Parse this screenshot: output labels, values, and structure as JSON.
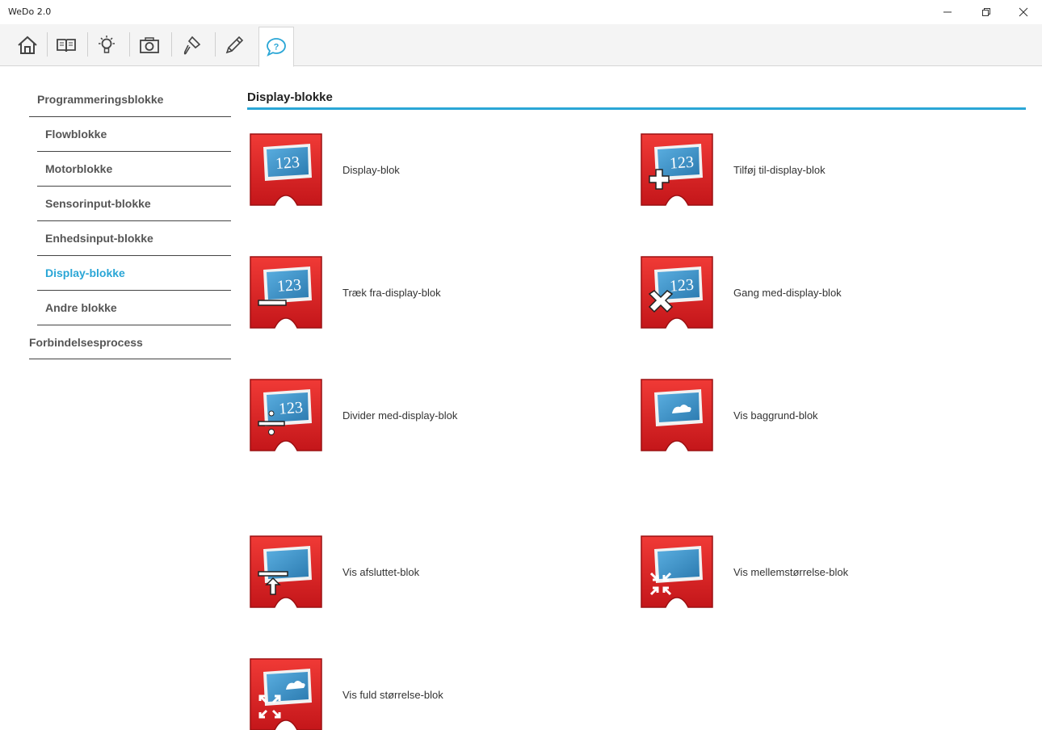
{
  "window": {
    "title": "WeDo 2.0",
    "controls": {
      "minimize": "—",
      "maximize": "❐",
      "close": "✕"
    }
  },
  "toolbar": {
    "buttons": [
      {
        "icon": "home-icon"
      },
      {
        "icon": "book-icon"
      },
      {
        "icon": "lightbulb-icon"
      },
      {
        "icon": "camera-icon"
      },
      {
        "icon": "microphone-icon"
      },
      {
        "icon": "pencil-icon"
      },
      {
        "icon": "help-icon",
        "active": true
      }
    ],
    "accent": "#2aa6d6"
  },
  "sidebar": {
    "top": "Programmeringsblokke",
    "items": [
      {
        "label": "Flowblokke"
      },
      {
        "label": "Motorblokke"
      },
      {
        "label": "Sensorinput-blokke"
      },
      {
        "label": "Enhedsinput-blokke"
      },
      {
        "label": "Display-blokke",
        "active": true
      },
      {
        "label": "Andre blokke"
      }
    ],
    "bottom": "Forbindelsesprocess"
  },
  "main": {
    "title": "Display-blokke",
    "blocks": [
      {
        "label": "Display-blok",
        "icon": "display-123-icon"
      },
      {
        "label": "Tilføj til-display-blok",
        "icon": "display-add-icon"
      },
      {
        "label": "Træk fra-display-blok",
        "icon": "display-subtract-icon"
      },
      {
        "label": "Gang med-display-blok",
        "icon": "display-multiply-icon"
      },
      {
        "label": "Divider med-display-blok",
        "icon": "display-divide-icon"
      },
      {
        "label": "Vis baggrund-blok",
        "icon": "display-background-icon"
      },
      {
        "label": "Vis afsluttet-blok",
        "icon": "display-close-icon"
      },
      {
        "label": "Vis mellemstørrelse-blok",
        "icon": "display-medium-size-icon"
      },
      {
        "label": "Vis fuld størrelse-blok",
        "icon": "display-full-size-icon"
      }
    ],
    "block_color": "#d81e1e",
    "screen_color": "#3e8fc0",
    "block_glyph": "123"
  }
}
